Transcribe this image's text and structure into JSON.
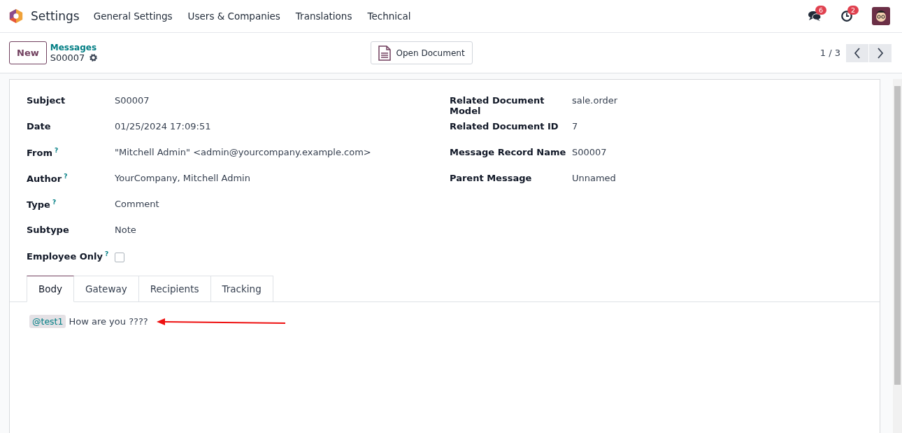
{
  "navbar": {
    "app_name": "Settings",
    "menu": [
      "General Settings",
      "Users & Companies",
      "Translations",
      "Technical"
    ],
    "messages_badge": "6",
    "activities_badge": "2"
  },
  "control_panel": {
    "new_button": "New",
    "breadcrumb": "Messages",
    "record_name": "S00007",
    "open_document": "Open Document",
    "pager": "1 / 3"
  },
  "left_fields": [
    {
      "label": "Subject",
      "value": "S00007",
      "kind": "text"
    },
    {
      "label": "Date",
      "value": "01/25/2024 17:09:51",
      "kind": "text"
    },
    {
      "label": "From",
      "help": "?",
      "value": "\"Mitchell Admin\" <admin@yourcompany.example.com>",
      "kind": "text"
    },
    {
      "label": "Author",
      "help": "?",
      "value": "YourCompany, Mitchell Admin",
      "kind": "text"
    },
    {
      "label": "Type",
      "help": "?",
      "value": "Comment",
      "kind": "text"
    },
    {
      "label": "Subtype",
      "value": "Note",
      "kind": "text"
    },
    {
      "label": "Employee Only",
      "help": "?",
      "checked": false,
      "kind": "checkbox"
    }
  ],
  "right_fields": [
    {
      "label": "Related Document Model",
      "value": "sale.order"
    },
    {
      "label": "Related Document ID",
      "value": "7"
    },
    {
      "label": "Message Record Name",
      "value": "S00007"
    },
    {
      "label": "Parent Message",
      "value": "Unnamed"
    }
  ],
  "tabs": [
    {
      "label": "Body",
      "selected": true
    },
    {
      "label": "Gateway",
      "selected": false
    },
    {
      "label": "Recipients",
      "selected": false
    },
    {
      "label": "Tracking",
      "selected": false
    }
  ],
  "body": {
    "mention": "@test1",
    "text": "How are you ????"
  }
}
